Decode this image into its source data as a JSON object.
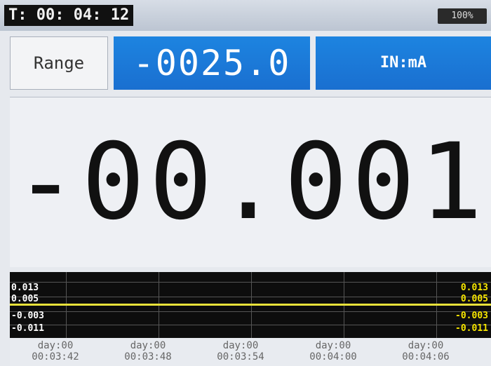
{
  "status": {
    "timer": "T: 00: 04: 12",
    "battery": "100%"
  },
  "range": {
    "label": "Range",
    "value": "-0025.0",
    "unit": "IN:mA"
  },
  "reading": {
    "value": "-00.001"
  },
  "graph": {
    "left_ticks": [
      "0.013",
      "0.005",
      "-0.003",
      "-0.011"
    ],
    "right_ticks": [
      "0.013",
      "0.005",
      "-0.003",
      "-0.011"
    ],
    "x_labels": [
      {
        "day": "day:00",
        "time": "00:03:42"
      },
      {
        "day": "day:00",
        "time": "00:03:48"
      },
      {
        "day": "day:00",
        "time": "00:03:54"
      },
      {
        "day": "day:00",
        "time": "00:04:00"
      },
      {
        "day": "day:00",
        "time": "00:04:06"
      }
    ],
    "colors": {
      "trace": "#e8e23a",
      "right_ticks": "#f7e600",
      "background": "#0d0d0d"
    }
  }
}
